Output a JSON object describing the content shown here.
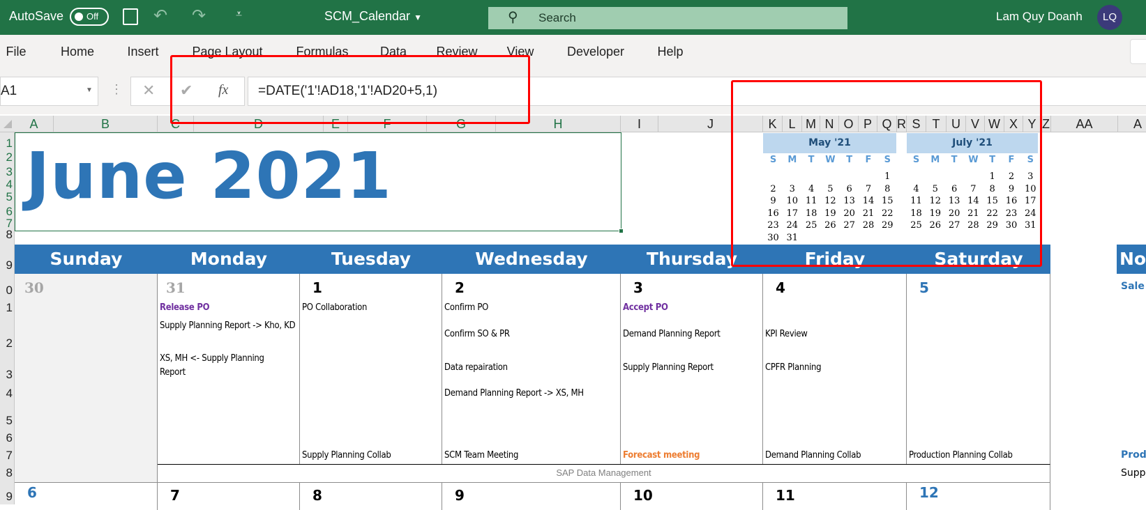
{
  "titlebar": {
    "autosave": "AutoSave",
    "toggle": "Off",
    "filename": "SCM_Calendar",
    "search": "Search",
    "user": "Lam Quy Doanh",
    "initials": "LQ"
  },
  "ribbon": {
    "tabs": [
      "File",
      "Home",
      "Insert",
      "Page Layout",
      "Formulas",
      "Data",
      "Review",
      "View",
      "Developer",
      "Help"
    ]
  },
  "formula_bar": {
    "name_box": "A1",
    "fx": "fx",
    "formula": "=DATE('1'!AD18,'1'!AD20+5,1)"
  },
  "columns": [
    "A",
    "B",
    "C",
    "D",
    "E",
    "F",
    "G",
    "H",
    "I",
    "J",
    "K",
    "L",
    "M",
    "N",
    "O",
    "P",
    "Q",
    "R",
    "S",
    "T",
    "U",
    "V",
    "W",
    "X",
    "Y",
    "Z",
    "AA",
    "A"
  ],
  "rows": [
    "1",
    "2",
    "3",
    "4",
    "5",
    "6",
    "7",
    "8",
    "9",
    "0",
    "1",
    "2",
    "3",
    "4",
    "5",
    "6",
    "7",
    "8",
    "9"
  ],
  "title": "June 2021",
  "mini_may": {
    "title": "May '21",
    "dow": [
      "S",
      "M",
      "T",
      "W",
      "T",
      "F",
      "S"
    ],
    "weeks": [
      [
        "",
        "",
        "",
        "",
        "",
        "",
        "1"
      ],
      [
        "2",
        "3",
        "4",
        "5",
        "6",
        "7",
        "8"
      ],
      [
        "9",
        "10",
        "11",
        "12",
        "13",
        "14",
        "15"
      ],
      [
        "16",
        "17",
        "18",
        "19",
        "20",
        "21",
        "22"
      ],
      [
        "23",
        "24",
        "25",
        "26",
        "27",
        "28",
        "29"
      ],
      [
        "30",
        "31",
        "",
        "",
        "",
        "",
        ""
      ]
    ]
  },
  "mini_july": {
    "title": "July '21",
    "dow": [
      "S",
      "M",
      "T",
      "W",
      "T",
      "F",
      "S"
    ],
    "weeks": [
      [
        "",
        "",
        "",
        "",
        "1",
        "2",
        "3"
      ],
      [
        "4",
        "5",
        "6",
        "7",
        "8",
        "9",
        "10"
      ],
      [
        "11",
        "12",
        "13",
        "14",
        "15",
        "16",
        "17"
      ],
      [
        "18",
        "19",
        "20",
        "21",
        "22",
        "23",
        "24"
      ],
      [
        "25",
        "26",
        "27",
        "28",
        "29",
        "30",
        "31"
      ]
    ]
  },
  "days": [
    "Sunday",
    "Monday",
    "Tuesday",
    "Wednesday",
    "Thursday",
    "Friday",
    "Saturday"
  ],
  "week1": {
    "sun": {
      "date": "30"
    },
    "mon": {
      "date": "31",
      "e1": "Release PO",
      "e2": "Supply Planning Report -> Kho, KD",
      "e3": "XS, MH <- Supply Planning Report"
    },
    "tue": {
      "date": "1",
      "e1": "PO Collaboration",
      "bottom": "Supply Planning Collab"
    },
    "wed": {
      "date": "2",
      "e1": "Confirm PO",
      "e2": "Confirm SO & PR",
      "e3": "Data repairation",
      "e4": "Demand Planning Report -> XS, MH",
      "bottom": "SCM Team Meeting"
    },
    "thu": {
      "date": "3",
      "e1": "Accept PO",
      "e2": "Demand Planning Report",
      "e3": "Supply Planning Report",
      "bottom": "Forecast meeting"
    },
    "fri": {
      "date": "4",
      "e2": "KPI Review",
      "e3": "CPFR Planning",
      "bottom": "Demand Planning Collab"
    },
    "sat": {
      "date": "5",
      "bottom": "Production Planning Collab"
    },
    "footer": "SAP Data Management"
  },
  "week2": {
    "dates": [
      "6",
      "7",
      "8",
      "9",
      "10",
      "11",
      "12"
    ]
  },
  "notes": {
    "header": "No",
    "item1": "Sale",
    "item2": "Prod",
    "item3": "Supp"
  },
  "colors": {
    "excel_green": "#217346",
    "accent_blue": "#2e75b6",
    "purple": "#7030a0",
    "orange": "#ed7d31",
    "highlight": "#ff0000"
  }
}
